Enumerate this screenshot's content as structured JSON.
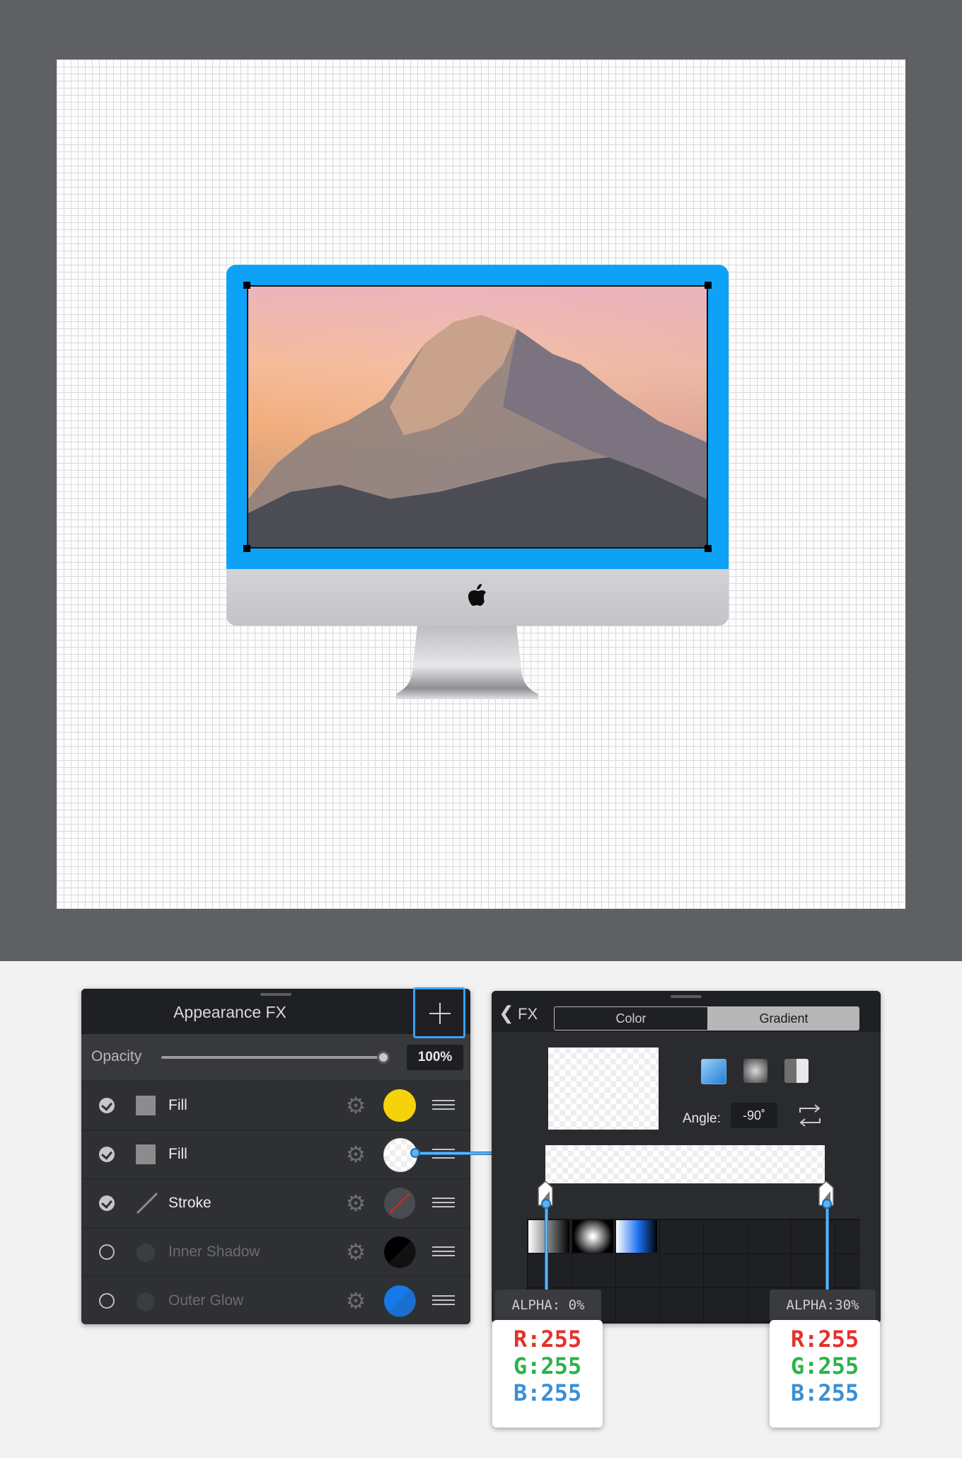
{
  "appearance_panel": {
    "title": "Appearance FX",
    "add_button": "+",
    "opacity": {
      "label": "Opacity",
      "value": "100%",
      "level": 1.0
    },
    "rows": [
      {
        "label": "Fill",
        "enabled": true,
        "icon": "fill-swatch-icon",
        "color": "#f6d20a"
      },
      {
        "label": "Fill",
        "enabled": true,
        "icon": "fill-swatch-icon",
        "color": "#ffffff"
      },
      {
        "label": "Stroke",
        "enabled": true,
        "icon": "stroke-line-icon",
        "color": "none"
      },
      {
        "label": "Inner Shadow",
        "enabled": false,
        "icon": "inner-shadow-icon",
        "color": "#000000"
      },
      {
        "label": "Outer Glow",
        "enabled": false,
        "icon": "outer-glow-icon",
        "color": "#1679e8"
      }
    ]
  },
  "gradient_panel": {
    "back_label": "FX",
    "tabs": {
      "color": "Color",
      "gradient": "Gradient",
      "active": "Gradient"
    },
    "angle_label": "Angle:",
    "angle_value": "-90˚",
    "gradient_types": [
      "linear-gradient-icon",
      "radial-gradient-icon",
      "corner-gradient-icon"
    ]
  },
  "stops": [
    {
      "alpha_label": "ALPHA: 0%",
      "r": "R:255",
      "g": "G:255",
      "b": "B:255"
    },
    {
      "alpha_label": "ALPHA:30%",
      "r": "R:255",
      "g": "G:255",
      "b": "B:255"
    }
  ],
  "colors": {
    "accent": "#3aa1ef",
    "imac_frame": "#0ea2f7",
    "canvas_bg": "#5f6063"
  }
}
